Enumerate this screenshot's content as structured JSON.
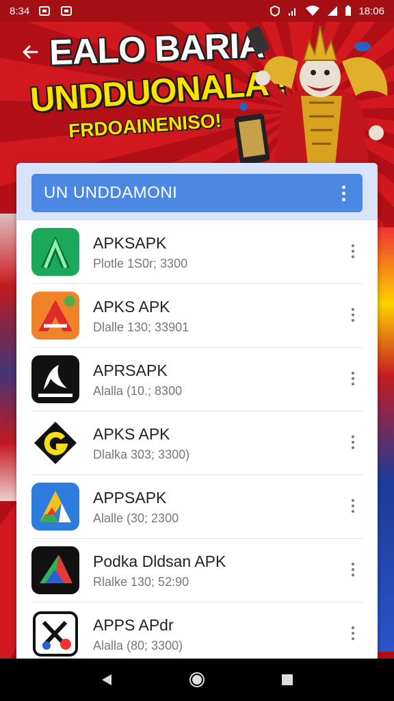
{
  "status_bar": {
    "left_time": "8:34",
    "right_time": "18:06"
  },
  "banner": {
    "line1": "EALO BARIA",
    "line2": "UNDDUONALA'!",
    "line3": "FRDOAINENISO!"
  },
  "panel": {
    "title": "UN UNDDAMONI"
  },
  "apps": [
    {
      "name": "APKSAPK",
      "meta": "Plotle 1S0r; 3300",
      "icon": "green-a-app-icon"
    },
    {
      "name": "APKS APK",
      "meta": "Dlalle 130; 33901",
      "icon": "orange-a-app-icon"
    },
    {
      "name": "APRSAPK",
      "meta": "Alalla (10.; 8300",
      "icon": "black-stylized-app-icon"
    },
    {
      "name": "APKS APK",
      "meta": "Dlalka 303; 3300)",
      "icon": "yellow-g-app-icon"
    },
    {
      "name": "APPSAPK",
      "meta": "Alalle (30; 2300",
      "icon": "multicolor-a-app-icon"
    },
    {
      "name": "Podka Dldsan APK",
      "meta": "Rlalke 130; 52:90",
      "icon": "black-triangle-app-icon"
    },
    {
      "name": "APPS APdr",
      "meta": "Alalla (80; 3300)",
      "icon": "black-x-app-icon"
    }
  ],
  "colors": {
    "header_blue": "#4a88e4",
    "banner_red": "#d1181f",
    "banner_yellow": "#ffe100"
  },
  "nav": [
    "back-icon",
    "home-icon",
    "recents-icon"
  ]
}
